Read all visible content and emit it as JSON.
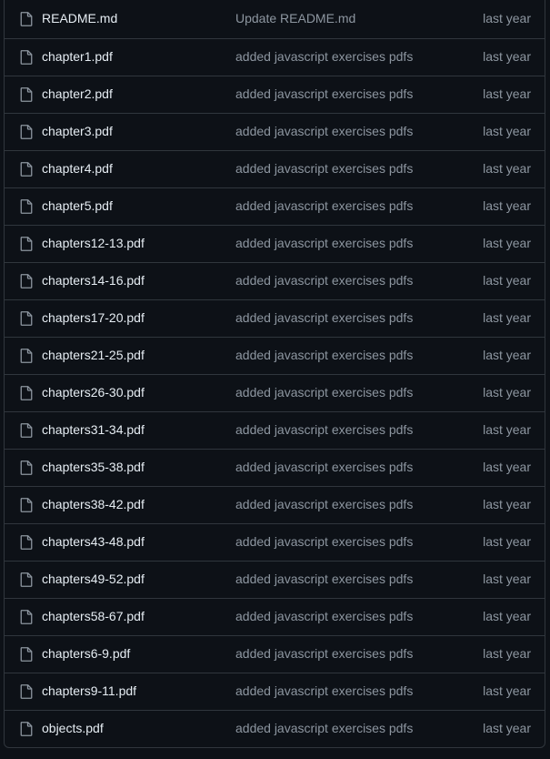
{
  "files": [
    {
      "name": "README.md",
      "message": "Update README.md",
      "age": "last year",
      "icon": "file-icon"
    },
    {
      "name": "chapter1.pdf",
      "message": "added javascript exercises pdfs",
      "age": "last year",
      "icon": "file-icon"
    },
    {
      "name": "chapter2.pdf",
      "message": "added javascript exercises pdfs",
      "age": "last year",
      "icon": "file-icon"
    },
    {
      "name": "chapter3.pdf",
      "message": "added javascript exercises pdfs",
      "age": "last year",
      "icon": "file-icon"
    },
    {
      "name": "chapter4.pdf",
      "message": "added javascript exercises pdfs",
      "age": "last year",
      "icon": "file-icon"
    },
    {
      "name": "chapter5.pdf",
      "message": "added javascript exercises pdfs",
      "age": "last year",
      "icon": "file-icon"
    },
    {
      "name": "chapters12-13.pdf",
      "message": "added javascript exercises pdfs",
      "age": "last year",
      "icon": "file-icon"
    },
    {
      "name": "chapters14-16.pdf",
      "message": "added javascript exercises pdfs",
      "age": "last year",
      "icon": "file-icon"
    },
    {
      "name": "chapters17-20.pdf",
      "message": "added javascript exercises pdfs",
      "age": "last year",
      "icon": "file-icon"
    },
    {
      "name": "chapters21-25.pdf",
      "message": "added javascript exercises pdfs",
      "age": "last year",
      "icon": "file-icon"
    },
    {
      "name": "chapters26-30.pdf",
      "message": "added javascript exercises pdfs",
      "age": "last year",
      "icon": "file-icon"
    },
    {
      "name": "chapters31-34.pdf",
      "message": "added javascript exercises pdfs",
      "age": "last year",
      "icon": "file-icon"
    },
    {
      "name": "chapters35-38.pdf",
      "message": "added javascript exercises pdfs",
      "age": "last year",
      "icon": "file-icon"
    },
    {
      "name": "chapters38-42.pdf",
      "message": "added javascript exercises pdfs",
      "age": "last year",
      "icon": "file-icon"
    },
    {
      "name": "chapters43-48.pdf",
      "message": "added javascript exercises pdfs",
      "age": "last year",
      "icon": "file-icon"
    },
    {
      "name": "chapters49-52.pdf",
      "message": "added javascript exercises pdfs",
      "age": "last year",
      "icon": "file-icon"
    },
    {
      "name": "chapters58-67.pdf",
      "message": "added javascript exercises pdfs",
      "age": "last year",
      "icon": "file-icon"
    },
    {
      "name": "chapters6-9.pdf",
      "message": "added javascript exercises pdfs",
      "age": "last year",
      "icon": "file-icon"
    },
    {
      "name": "chapters9-11.pdf",
      "message": "added javascript exercises pdfs",
      "age": "last year",
      "icon": "file-icon"
    },
    {
      "name": "objects.pdf",
      "message": "added javascript exercises pdfs",
      "age": "last year",
      "icon": "file-icon"
    }
  ],
  "colors": {
    "background": "#0d1117",
    "border": "#30363d",
    "text": "#e6edf3",
    "muted": "#8d96a0"
  }
}
